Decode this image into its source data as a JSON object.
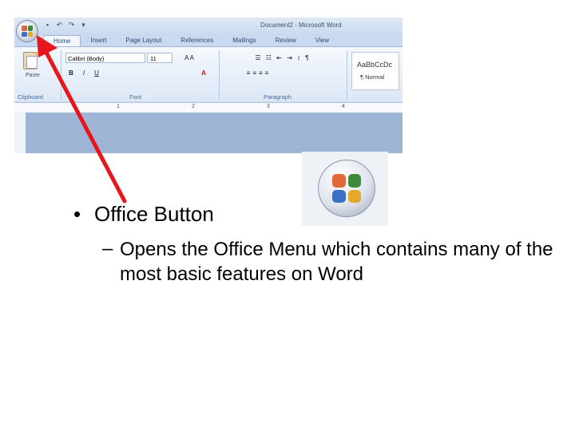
{
  "word_window": {
    "title": "Document2 - Microsoft Word",
    "tabs": [
      "Home",
      "Insert",
      "Page Layout",
      "References",
      "Mailings",
      "Review",
      "View"
    ],
    "font_name": "Calibri (Body)",
    "font_size": "11",
    "paste_label": "Paste",
    "groups": [
      "Clipboard",
      "Font",
      "Paragraph"
    ],
    "style_sample": "AaBbCcDc",
    "style_name": "¶ Normal",
    "ruler_numbers": [
      "1",
      "2",
      "3",
      "4"
    ]
  },
  "slide": {
    "bullet_symbol": "•",
    "bullet": "Office Button",
    "sub_dash": "–",
    "sub_bullet": "Opens the Office Menu which contains many of the most basic features on Word"
  },
  "colors": {
    "arrow": "#e8161b",
    "logo": [
      "#e0673a",
      "#3c8a3a",
      "#3b6fc4",
      "#e2a92b"
    ]
  },
  "icons": [
    "office-button-icon",
    "save-icon",
    "undo-icon",
    "redo-icon"
  ]
}
